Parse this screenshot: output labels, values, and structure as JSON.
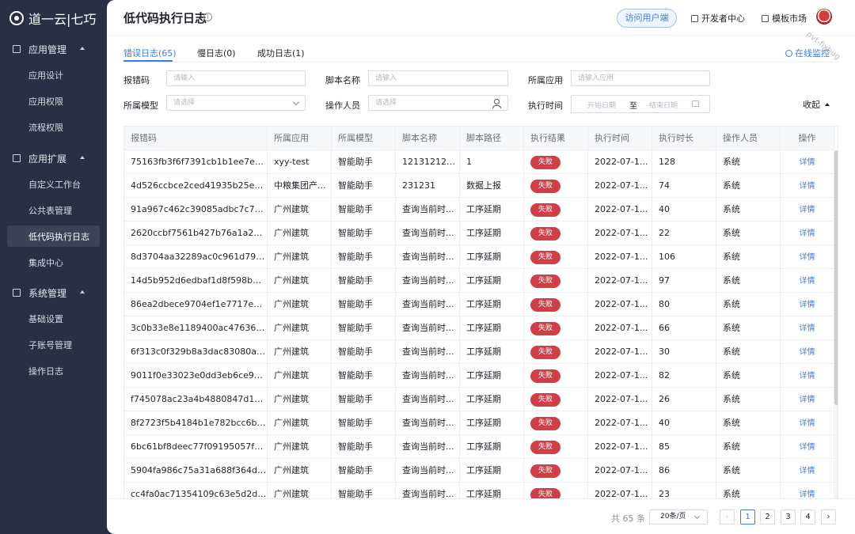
{
  "app": {
    "logo_text": "道一云|七巧"
  },
  "sidebar": {
    "groups": [
      {
        "label": "应用管理",
        "icon": "grid-icon",
        "items": [
          "应用设计",
          "应用权限",
          "流程权限"
        ]
      },
      {
        "label": "应用扩展",
        "icon": "document-icon",
        "items": [
          "自定义工作台",
          "公共表管理",
          "低代码执行日志",
          "集成中心"
        ]
      },
      {
        "label": "系统管理",
        "icon": "table-icon",
        "items": [
          "基础设置",
          "子账号管理",
          "操作日志"
        ]
      }
    ],
    "active_item": "低代码执行日志"
  },
  "header": {
    "title": "低代码执行日志",
    "info_icon": "i",
    "visit_button": "访问用户端",
    "dev_center": "开发者中心",
    "template_market": "模板市场",
    "watermark": "pvt-fixbug"
  },
  "tabs": [
    {
      "label": "错误日志(65)",
      "active": true
    },
    {
      "label": "慢日志(0)",
      "active": false
    },
    {
      "label": "成功日志(1)",
      "active": false
    }
  ],
  "monitor_link": "在线监控",
  "filters": {
    "error_code": {
      "label": "报错码",
      "placeholder": "请输入"
    },
    "script_name": {
      "label": "脚本名称",
      "placeholder": "请输入"
    },
    "app": {
      "label": "所属应用",
      "placeholder": "请输入应用"
    },
    "model": {
      "label": "所属模型",
      "placeholder": "请选择"
    },
    "operator": {
      "label": "操作人员",
      "placeholder": "请选择"
    },
    "exec_time": {
      "label": "执行时间",
      "start": "开始日期",
      "separator": "至",
      "end": "结束日期"
    },
    "collapse": "收起"
  },
  "table": {
    "columns": [
      "报错码",
      "所属应用",
      "所属模型",
      "脚本名称",
      "脚本路径",
      "执行结果",
      "执行时间",
      "执行时长",
      "操作人员",
      "操作"
    ],
    "rows": [
      [
        "75163fb3f6f7391cb1b1ee7ecd2...",
        "xyy-test",
        "智能助手",
        "12131212ce...",
        "1",
        "失败",
        "2022-07-1...",
        "128",
        "系统",
        "详情"
      ],
      [
        "4d526ccbce2ced41935b25eb9...",
        "中粮集团产...",
        "智能助手",
        "231231",
        "数据上报",
        "失败",
        "2022-07-1...",
        "74",
        "系统",
        "详情"
      ],
      [
        "91a967c462c39085adbc7c726...",
        "广州建筑",
        "智能助手",
        "查询当前时...",
        "工序延期",
        "失败",
        "2022-07-1...",
        "40",
        "系统",
        "详情"
      ],
      [
        "2620ccbf7561b427b76a1a225f...",
        "广州建筑",
        "智能助手",
        "查询当前时...",
        "工序延期",
        "失败",
        "2022-07-1...",
        "22",
        "系统",
        "详情"
      ],
      [
        "8d3704aa32289ac0c961d7951...",
        "广州建筑",
        "智能助手",
        "查询当前时...",
        "工序延期",
        "失败",
        "2022-07-1...",
        "106",
        "系统",
        "详情"
      ],
      [
        "14d5b952d6edbaf1d8f598bd39...",
        "广州建筑",
        "智能助手",
        "查询当前时...",
        "工序延期",
        "失败",
        "2022-07-1...",
        "97",
        "系统",
        "详情"
      ],
      [
        "86ea2dbece9704ef1e7717e15b...",
        "广州建筑",
        "智能助手",
        "查询当前时...",
        "工序延期",
        "失败",
        "2022-07-1...",
        "80",
        "系统",
        "详情"
      ],
      [
        "3c0b33e8e1189400ac476369c...",
        "广州建筑",
        "智能助手",
        "查询当前时...",
        "工序延期",
        "失败",
        "2022-07-1...",
        "66",
        "系统",
        "详情"
      ],
      [
        "6f313c0f329b8a3dac83080acf...",
        "广州建筑",
        "智能助手",
        "查询当前时...",
        "工序延期",
        "失败",
        "2022-07-1...",
        "30",
        "系统",
        "详情"
      ],
      [
        "9011f0e33023e0dd3eb6ce943...",
        "广州建筑",
        "智能助手",
        "查询当前时...",
        "工序延期",
        "失败",
        "2022-07-1...",
        "82",
        "系统",
        "详情"
      ],
      [
        "f745078ac23a4b4880847d1139...",
        "广州建筑",
        "智能助手",
        "查询当前时...",
        "工序延期",
        "失败",
        "2022-07-1...",
        "26",
        "系统",
        "详情"
      ],
      [
        "8f2723f5b4184b1e782bcc6bee...",
        "广州建筑",
        "智能助手",
        "查询当前时...",
        "工序延期",
        "失败",
        "2022-07-1...",
        "40",
        "系统",
        "详情"
      ],
      [
        "6bc61bf8deec77f09195057f0c...",
        "广州建筑",
        "智能助手",
        "查询当前时...",
        "工序延期",
        "失败",
        "2022-07-1...",
        "85",
        "系统",
        "详情"
      ],
      [
        "5904fa986c75a31a688f364df9...",
        "广州建筑",
        "智能助手",
        "查询当前时...",
        "工序延期",
        "失败",
        "2022-07-1...",
        "86",
        "系统",
        "详情"
      ],
      [
        "cc4fa0ac71354109c63e5d2dd0...",
        "广州建筑",
        "智能助手",
        "查询当前时...",
        "工序延期",
        "失败",
        "2022-07-1...",
        "23",
        "系统",
        "详情"
      ]
    ]
  },
  "pagination": {
    "total": "共 65 条",
    "page_size": "20条/页",
    "pages": [
      "1",
      "2",
      "3",
      "4"
    ],
    "current": "1",
    "prev": "‹",
    "next": "›"
  },
  "colors": {
    "accent": "#3b7de8",
    "sidebar_bg": "#2b2f45",
    "fail_badge": "#cf3f45"
  }
}
